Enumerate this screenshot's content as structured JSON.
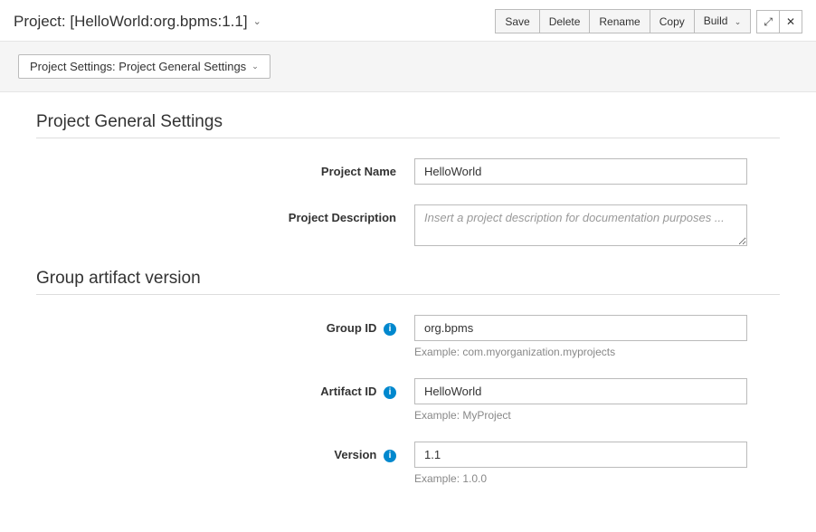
{
  "header": {
    "project_label": "Project: [HelloWorld:org.bpms:1.1]",
    "actions": {
      "save": "Save",
      "delete": "Delete",
      "rename": "Rename",
      "copy": "Copy",
      "build": "Build"
    }
  },
  "breadcrumb": {
    "label": "Project Settings: Project General Settings"
  },
  "sections": {
    "general": {
      "title": "Project General Settings",
      "project_name_label": "Project Name",
      "project_name_value": "HelloWorld",
      "project_desc_label": "Project Description",
      "project_desc_placeholder": "Insert a project description for documentation purposes ..."
    },
    "gav": {
      "title": "Group artifact version",
      "group_id_label": "Group ID",
      "group_id_value": "org.bpms",
      "group_id_help": "Example: com.myorganization.myprojects",
      "artifact_id_label": "Artifact ID",
      "artifact_id_value": "HelloWorld",
      "artifact_id_help": "Example: MyProject",
      "version_label": "Version",
      "version_value": "1.1",
      "version_help": "Example: 1.0.0"
    }
  }
}
